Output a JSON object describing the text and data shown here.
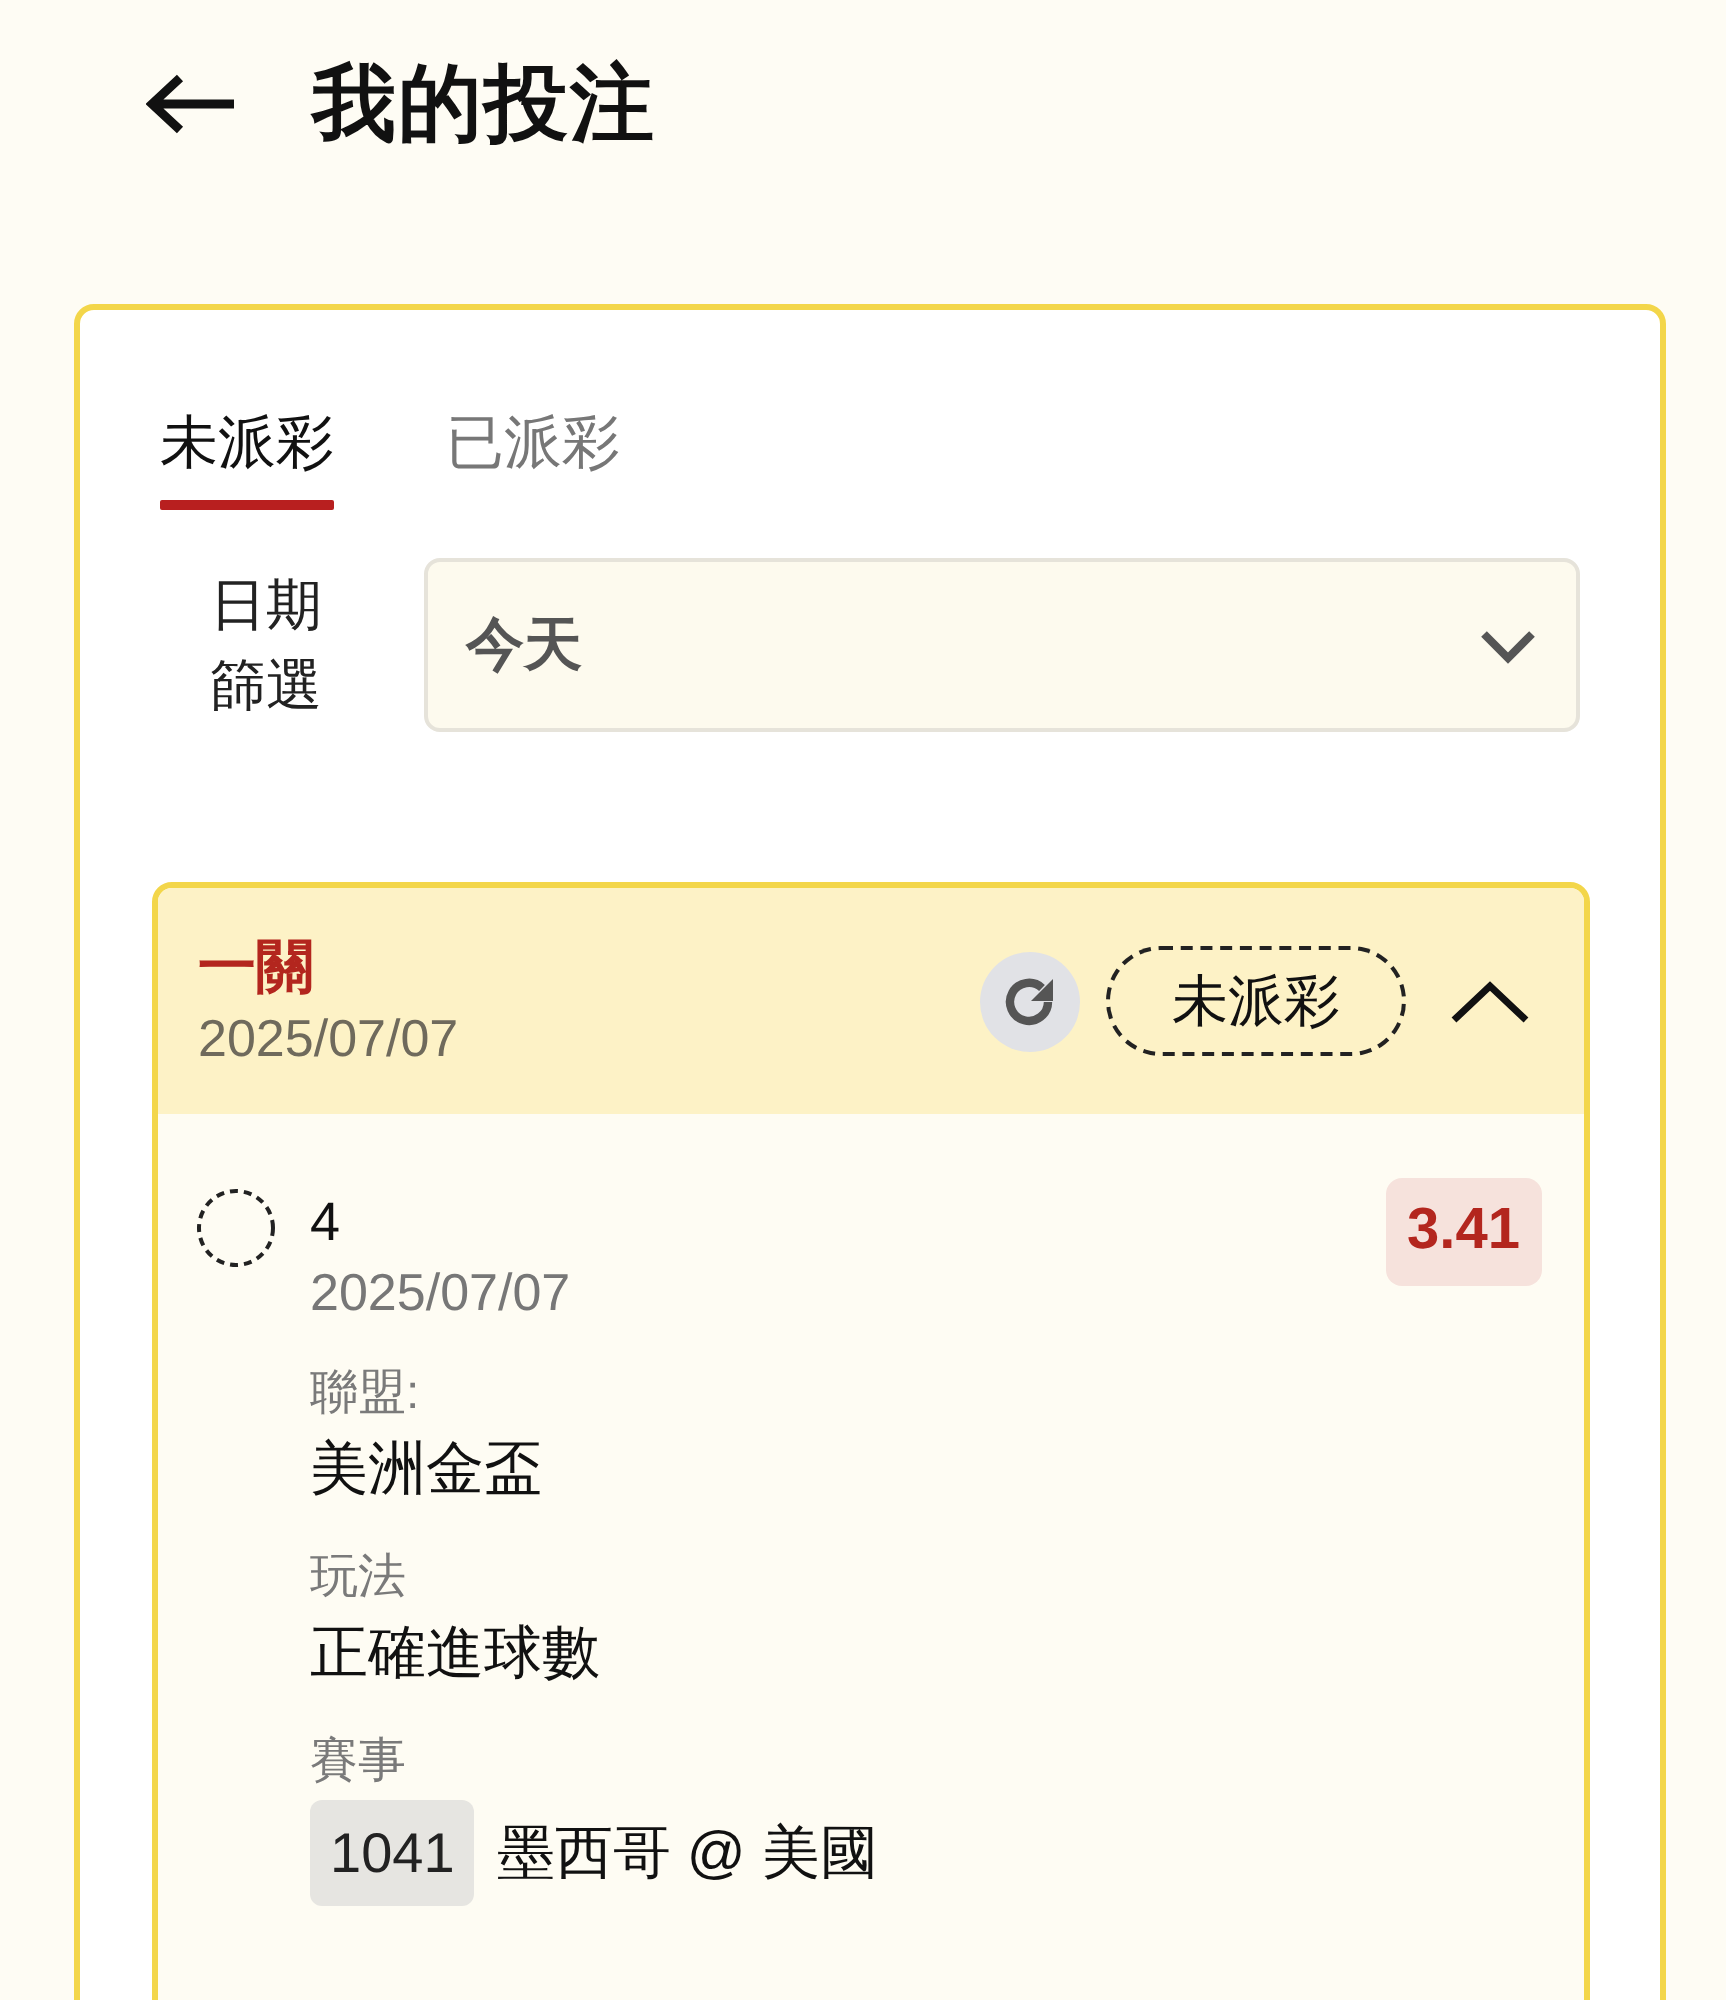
{
  "header": {
    "title": "我的投注"
  },
  "tabs": [
    {
      "label": "未派彩",
      "selected": true
    },
    {
      "label": "已派彩",
      "selected": false
    }
  ],
  "date_filter": {
    "label": "日期篩選",
    "value": "今天"
  },
  "bets": [
    {
      "type": "一關",
      "date": "2025/07/07",
      "status": "未派彩",
      "expanded": true,
      "selections": [
        {
          "selection": "4",
          "date": "2025/07/07",
          "odds": "3.41",
          "fields": [
            {
              "kind": "text",
              "label": "聯盟:",
              "value": "美洲金盃"
            },
            {
              "kind": "text",
              "label": "玩法",
              "value": "正確進球數"
            },
            {
              "kind": "match",
              "label": "賽事",
              "match_number": "1041",
              "value": "墨西哥 @ 美國"
            }
          ]
        }
      ]
    }
  ]
}
